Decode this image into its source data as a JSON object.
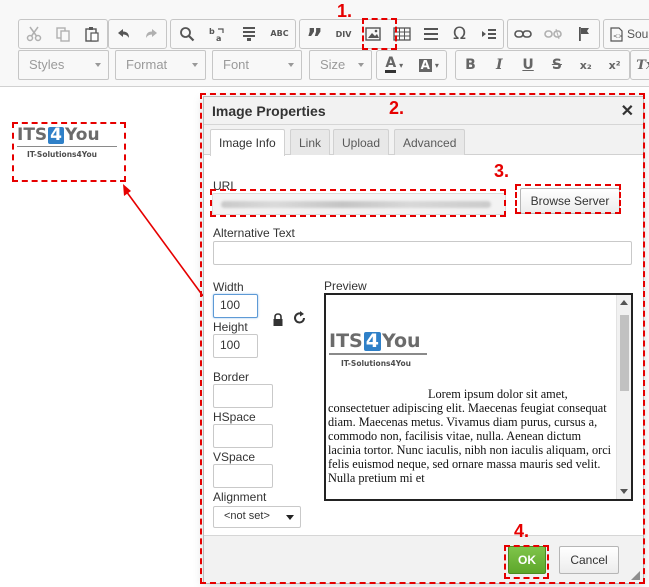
{
  "toolbar": {
    "row1_icons": [
      "cut-icon",
      "copy-icon",
      "paste-icon",
      "undo-icon",
      "redo-icon",
      "find-icon",
      "replace-icon",
      "select-all-icon",
      "spellcheck-icon",
      "blockquote-icon",
      "div-icon",
      "image-icon",
      "table-icon",
      "horizontal-line-icon",
      "special-char-icon",
      "page-break-icon",
      "link-icon",
      "unlink-icon",
      "anchor-icon"
    ],
    "spellcheck_label": "ABC",
    "blockquote_glyph": "”",
    "div_label": "DIV",
    "special_char_glyph": "Ω",
    "source_label": "Sou",
    "styles_combo": "Styles",
    "format_combo": "Format",
    "font_combo": "Font",
    "size_combo": "Size",
    "text_color_glyph": "A",
    "bg_color_glyph": "A",
    "bold_glyph": "B",
    "italic_glyph": "I",
    "underline_glyph": "U",
    "strike_glyph": "S",
    "subscript_glyph": "x₂",
    "superscript_glyph": "x²",
    "remove_format_glyph": "Tx"
  },
  "annotations": {
    "step1": "1.",
    "step2": "2.",
    "step3": "3.",
    "step4": "4.",
    "color": "#e60000"
  },
  "logo": {
    "its": "ITS",
    "four": "4",
    "you": "You",
    "tagline": "IT-Solutions4You",
    "brand_blue": "#2f80c8"
  },
  "dialog": {
    "title": "Image Properties",
    "close_glyph": "✕",
    "tabs": [
      {
        "label": "Image Info",
        "active": true
      },
      {
        "label": "Link",
        "active": false
      },
      {
        "label": "Upload",
        "active": false
      },
      {
        "label": "Advanced",
        "active": false
      }
    ],
    "url_label": "URL",
    "browse_server_label": "Browse Server",
    "alt_text_label": "Alternative Text",
    "alt_text_value": "",
    "width_label": "Width",
    "width_value": "100",
    "height_label": "Height",
    "height_value": "100",
    "border_label": "Border",
    "border_value": "",
    "hspace_label": "HSpace",
    "hspace_value": "",
    "vspace_label": "VSpace",
    "vspace_value": "",
    "alignment_label": "Alignment",
    "alignment_value": "<not set>",
    "preview_label": "Preview",
    "preview_text": "Lorem ipsum dolor sit amet, consectetuer adipiscing elit. Maecenas feugiat consequat diam. Maecenas metus. Vivamus diam purus, cursus a, commodo non, facilisis vitae, nulla. Aenean dictum lacinia tortor. Nunc iaculis, nibh non iaculis aliquam, orci felis euismod neque, sed ornare massa mauris sed velit. Nulla pretium mi et",
    "ok_label": "OK",
    "cancel_label": "Cancel",
    "ok_color": "#6ab534"
  }
}
